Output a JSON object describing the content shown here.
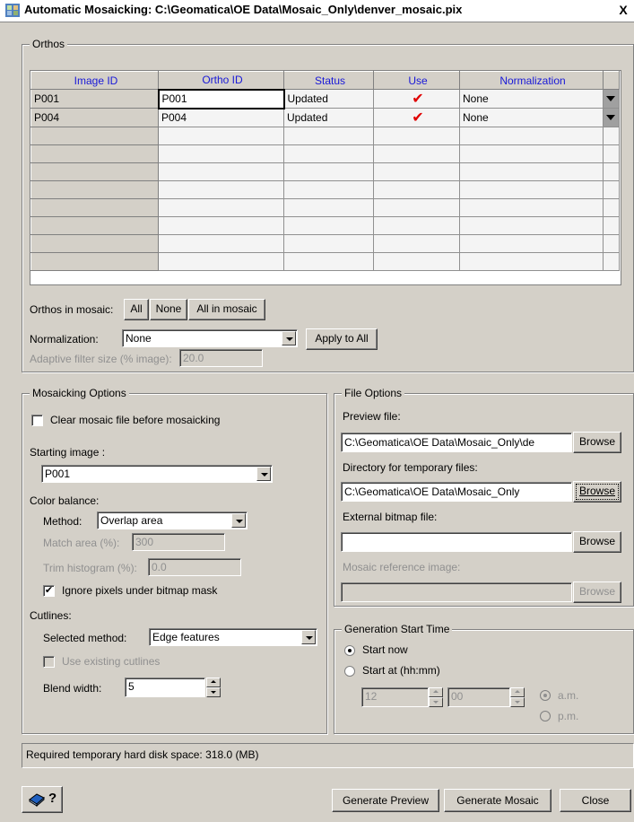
{
  "window": {
    "title": "Automatic Mosaicking: C:\\Geomatica\\OE Data\\Mosaic_Only\\denver_mosaic.pix",
    "close_label": "X"
  },
  "orthos": {
    "legend": "Orthos",
    "columns": [
      "Image ID",
      "Ortho ID",
      "Status",
      "Use",
      "Normalization"
    ],
    "rows": [
      {
        "image_id": "P001",
        "ortho_id": "P001",
        "status": "Updated",
        "use": "✔",
        "normalization": "None"
      },
      {
        "image_id": "P004",
        "ortho_id": "P004",
        "status": "Updated",
        "use": "✔",
        "normalization": "None"
      }
    ],
    "empty_rows": 8,
    "orthos_in_mosaic_label": "Orthos in mosaic:",
    "btn_all": "All",
    "btn_none": "None",
    "btn_all_in_mosaic": "All in mosaic",
    "normalization_label": "Normalization:",
    "normalization_value": "None",
    "apply_to_all": "Apply to All",
    "adaptive_label": "Adaptive filter size (% image):",
    "adaptive_value": "20.0"
  },
  "mosaicking": {
    "legend": "Mosaicking Options",
    "clear_label": "Clear mosaic file before mosaicking",
    "clear_checked": false,
    "starting_image_label": "Starting image :",
    "starting_image_value": "P001",
    "color_balance_label": "Color balance:",
    "method_label": "Method:",
    "method_value": "Overlap area",
    "match_area_label": "Match area (%):",
    "match_area_value": "300",
    "trim_label": "Trim histogram (%):",
    "trim_value": "0.0",
    "ignore_label": "Ignore pixels under bitmap mask",
    "ignore_checked": true,
    "cutlines_label": "Cutlines:",
    "selected_method_label": "Selected method:",
    "selected_method_value": "Edge features",
    "use_existing_label": "Use existing cutlines",
    "blend_label": "Blend width:",
    "blend_value": "5"
  },
  "file_options": {
    "legend": "File Options",
    "preview_label": "Preview file:",
    "preview_value": "C:\\Geomatica\\OE Data\\Mosaic_Only\\de",
    "browse": "Browse",
    "tempdir_label": "Directory for temporary files:",
    "tempdir_value": "C:\\Geomatica\\OE Data\\Mosaic_Only",
    "bitmap_label": "External bitmap file:",
    "bitmap_value": "",
    "reference_label": "Mosaic reference image:",
    "reference_value": ""
  },
  "generation": {
    "legend": "Generation Start Time",
    "start_now": "Start now",
    "start_at": "Start at (hh:mm)",
    "selected": "start_now",
    "hour": "12",
    "minute": "00",
    "am": "a.m.",
    "pm": "p.m."
  },
  "status": {
    "text": "Required temporary hard disk space: 318.0 (MB)"
  },
  "footer": {
    "help_glyph": "?",
    "generate_preview": "Generate Preview",
    "generate_mosaic": "Generate Mosaic",
    "close": "Close"
  },
  "colors": {
    "header_text": "#1818d8",
    "check": "#e00000",
    "face": "#d4d0c8"
  }
}
